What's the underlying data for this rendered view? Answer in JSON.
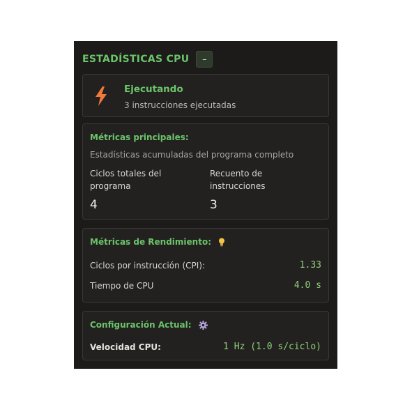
{
  "header": {
    "title": "ESTADÍSTICAS CPU",
    "collapse_label": "–"
  },
  "status": {
    "icon": "lightning-bolt-icon",
    "title": "Ejecutando",
    "subtitle": "3 instrucciones ejecutadas"
  },
  "main_metrics": {
    "title": "Métricas principales:",
    "description": "Estadísticas acumuladas del programa completo",
    "items": [
      {
        "label": "Ciclos totales del programa",
        "value": "4"
      },
      {
        "label": "Recuento de instrucciones",
        "value": "3"
      }
    ]
  },
  "performance": {
    "title": "Métricas de Rendimiento:",
    "icon": "lightbulb-icon",
    "rows": [
      {
        "label": "Ciclos por instrucción (CPI):",
        "value": "1.33"
      },
      {
        "label": "Tiempo de CPU",
        "value": "4.0 s"
      }
    ]
  },
  "config": {
    "title": "Configuración Actual:",
    "icon": "gear-icon",
    "rows": [
      {
        "label": "Velocidad CPU:",
        "value": "1 Hz (1.0 s/ciclo)"
      }
    ]
  },
  "colors": {
    "panel_bg": "#1c1b19",
    "accent_green": "#6cc46a",
    "bolt_orange": "#f07a3a"
  }
}
